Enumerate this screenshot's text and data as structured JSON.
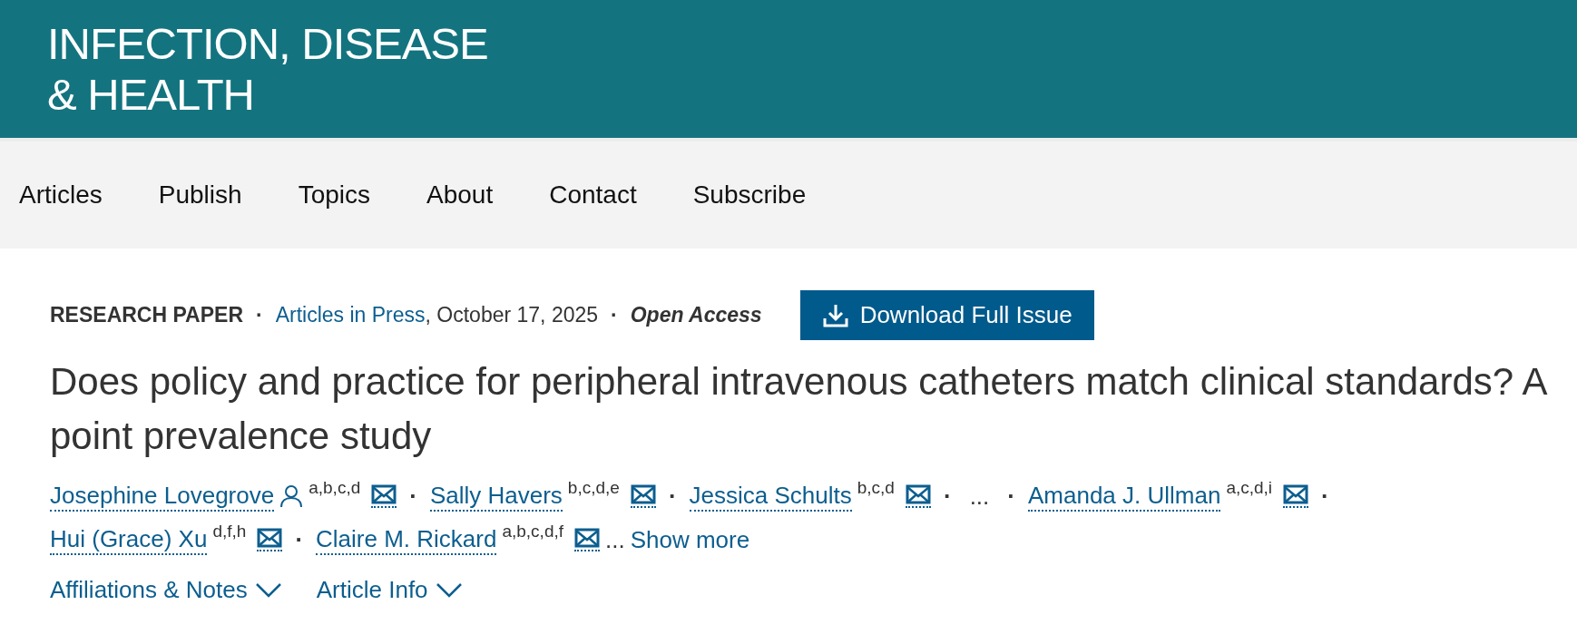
{
  "journal": {
    "title_lines": [
      "INFECTION, DISEASE",
      "& HEALTH"
    ]
  },
  "nav": [
    {
      "label": "Articles"
    },
    {
      "label": "Publish"
    },
    {
      "label": "Topics"
    },
    {
      "label": "About"
    },
    {
      "label": "Contact"
    },
    {
      "label": "Subscribe"
    }
  ],
  "meta": [
    {
      "kind": "type",
      "text": "RESEARCH PAPER"
    },
    {
      "kind": "separator",
      "text": "·"
    },
    {
      "kind": "link",
      "text": "Articles in Press"
    },
    {
      "kind": "text",
      "text": ", October 17, 2025"
    },
    {
      "kind": "separator",
      "text": "·"
    },
    {
      "kind": "access",
      "text": "Open Access"
    }
  ],
  "download_button": {
    "label": "Download Full Issue"
  },
  "title": "Does policy and practice for peripheral intravenous catheters match clinical standards? A point prevalence study",
  "authors": [
    {
      "kind": "author",
      "name": "Josephine Lovegrove",
      "person_icon": true,
      "affiliations": "a,b,c,d"
    },
    {
      "kind": "separator",
      "text": "·"
    },
    {
      "kind": "author",
      "name": "Sally Havers",
      "person_icon": false,
      "affiliations": "b,c,d,e"
    },
    {
      "kind": "separator",
      "text": "·"
    },
    {
      "kind": "author",
      "name": "Jessica Schults",
      "person_icon": false,
      "affiliations": "b,c,d"
    },
    {
      "kind": "separator",
      "text": "·"
    },
    {
      "kind": "ellipsis",
      "text": "..."
    },
    {
      "kind": "separator",
      "text": "·"
    },
    {
      "kind": "author",
      "name": "Amanda J. Ullman",
      "person_icon": false,
      "affiliations": "a,c,d,i"
    },
    {
      "kind": "separator",
      "text": "·"
    },
    {
      "kind": "break"
    },
    {
      "kind": "author",
      "name": "Hui (Grace) Xu",
      "person_icon": false,
      "affiliations": "d,f,h"
    },
    {
      "kind": "separator",
      "text": "·"
    },
    {
      "kind": "author",
      "name": "Claire M. Rickard",
      "person_icon": false,
      "affiliations": "a,b,c,d,f"
    },
    {
      "kind": "ellipsis",
      "text": "..."
    },
    {
      "kind": "show_more",
      "text": "Show more"
    }
  ],
  "toggles": [
    {
      "label": "Affiliations & Notes",
      "expanded": false
    },
    {
      "label": "Article Info",
      "expanded": false
    }
  ]
}
